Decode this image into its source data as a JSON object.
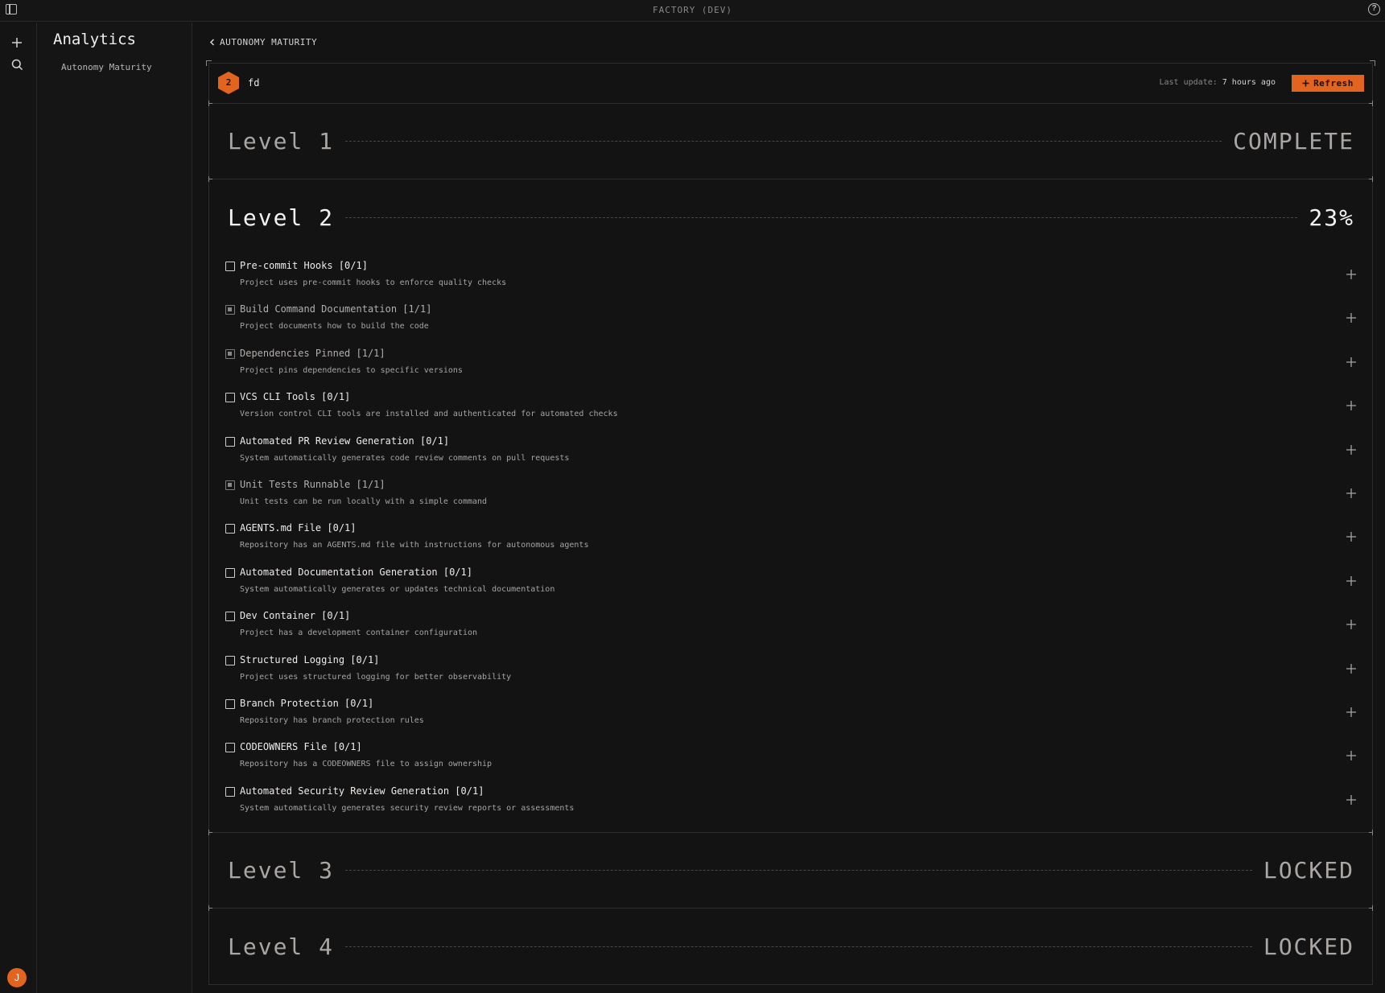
{
  "window": {
    "title": "FACTORY (DEV)"
  },
  "rail": {
    "avatar_initial": "J"
  },
  "sidebar": {
    "heading": "Analytics",
    "items": [
      {
        "label": "Autonomy Maturity"
      }
    ]
  },
  "breadcrumb": {
    "label": "AUTONOMY MATURITY"
  },
  "repo": {
    "badge": "2",
    "name": "fd",
    "last_update_label": "Last update:",
    "last_update_value": "7 hours ago",
    "refresh_label": "Refresh"
  },
  "levels": [
    {
      "name": "Level 1",
      "status": "COMPLETE"
    },
    {
      "name": "Level 2",
      "status": "23%"
    },
    {
      "name": "Level 3",
      "status": "LOCKED"
    },
    {
      "name": "Level 4",
      "status": "LOCKED"
    }
  ],
  "checklist": [
    {
      "label": "Pre-commit Hooks [0/1]",
      "desc": "Project uses pre-commit hooks to enforce quality checks",
      "done": false
    },
    {
      "label": "Build Command Documentation [1/1]",
      "desc": "Project documents how to build the code",
      "done": true
    },
    {
      "label": "Dependencies Pinned [1/1]",
      "desc": "Project pins dependencies to specific versions",
      "done": true
    },
    {
      "label": "VCS CLI Tools [0/1]",
      "desc": "Version control CLI tools are installed and authenticated for automated checks",
      "done": false
    },
    {
      "label": "Automated PR Review Generation [0/1]",
      "desc": "System automatically generates code review comments on pull requests",
      "done": false
    },
    {
      "label": "Unit Tests Runnable [1/1]",
      "desc": "Unit tests can be run locally with a simple command",
      "done": true
    },
    {
      "label": "AGENTS.md File [0/1]",
      "desc": "Repository has an AGENTS.md file with instructions for autonomous agents",
      "done": false
    },
    {
      "label": "Automated Documentation Generation [0/1]",
      "desc": "System automatically generates or updates technical documentation",
      "done": false
    },
    {
      "label": "Dev Container [0/1]",
      "desc": "Project has a development container configuration",
      "done": false
    },
    {
      "label": "Structured Logging [0/1]",
      "desc": "Project uses structured logging for better observability",
      "done": false
    },
    {
      "label": "Branch Protection [0/1]",
      "desc": "Repository has branch protection rules",
      "done": false
    },
    {
      "label": "CODEOWNERS File [0/1]",
      "desc": "Repository has a CODEOWNERS file to assign ownership",
      "done": false
    },
    {
      "label": "Automated Security Review Generation [0/1]",
      "desc": "System automatically generates security review reports or assessments",
      "done": false
    }
  ]
}
